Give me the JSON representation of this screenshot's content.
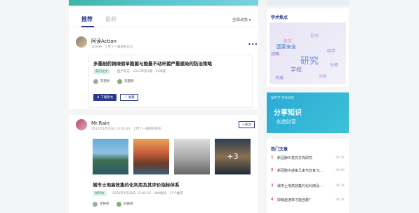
{
  "tabs": {
    "recommend": "推荐",
    "second": "最新",
    "filter": "全部动态 ▾"
  },
  "post1": {
    "user": "阿读Action",
    "meta": "10分钟 · 上传了一篇期刊论文",
    "title": "多重耐药铜绿假单胞菌与鲍曼不动杆菌严重感染的防治策略",
    "tag": "期刊论文",
    "detail": "医学杂志 · 2022年第1期 · 15阅读",
    "authors": [
      "李铭桥",
      "刘嘉明"
    ],
    "download": "下载原文",
    "collect": "收藏"
  },
  "post2": {
    "user": "Mr.Rain",
    "meta": "2022年1月30日 10:45:00 · 上传了一篇期刊原本",
    "follow": "+关注",
    "more_images": "+3",
    "title": "城市土地高效集约化利用及其评价指标体系",
    "tag": "预印本",
    "detail": "2022年1月30日 12:45:15 · 284阅读 · 17个推荐",
    "authors": [
      "李铭桥",
      "刘嘉明"
    ]
  },
  "sidebar": {
    "focus_title": "学术焦点",
    "cloud_words": [
      "国家安全",
      "战略",
      "研究",
      "学校",
      "科学",
      "教育",
      "分析",
      "生物",
      "发展",
      "管理"
    ],
    "banner_brand": "知学子·学术创作",
    "banner_title": "分享知识",
    "banner_sub": "创造财富",
    "hot_title": "热门文章",
    "hot_items": [
      {
        "num": "1",
        "title": "新冠肺炎变异方向研究",
        "count": "34.5K"
      },
      {
        "num": "2",
        "title": "新冠肺炎感染几率与饮食习...",
        "count": "34.5K"
      },
      {
        "num": "3",
        "title": "城市土地高效集约化利用及...",
        "count": "34.5K"
      },
      {
        "num": "4",
        "title": "抑郁症怎样才能自救？",
        "count": "34.5K"
      }
    ]
  },
  "colors": {
    "accent": "#2b3a8c",
    "tag_green": "#2a8f77",
    "hot_red": "#e34b3a"
  }
}
